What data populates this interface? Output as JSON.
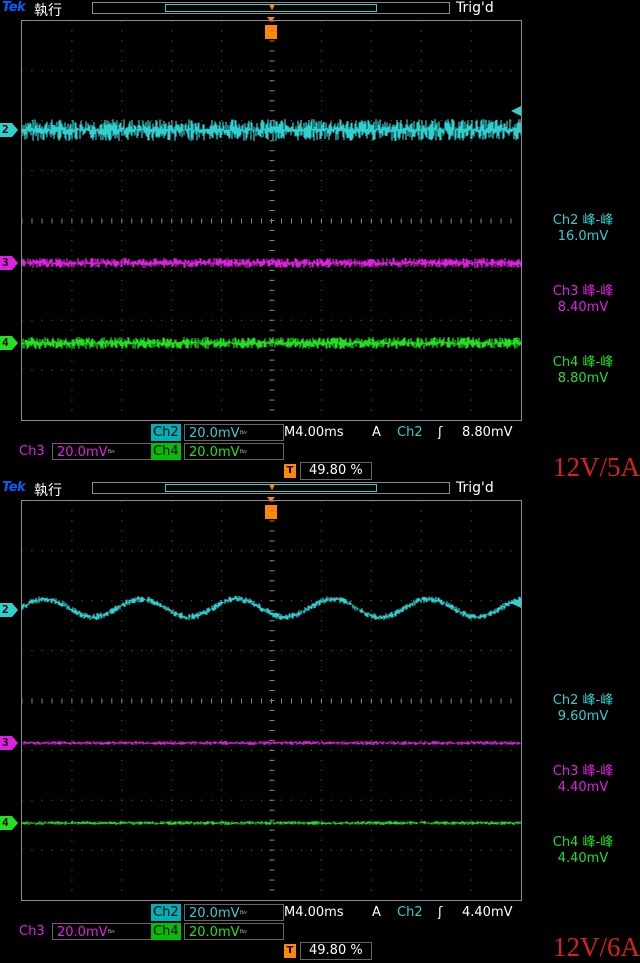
{
  "colors": {
    "ch2": "#30d0d0",
    "ch3": "#e020e0",
    "ch4": "#20e020",
    "trigger": "#ff8800",
    "load": "#d82020"
  },
  "screens": [
    {
      "brand": "Tek",
      "run_label": "執行",
      "trig_state": "Trig'd",
      "trig_marker": "T",
      "channel_markers": [
        "2",
        "3",
        "4"
      ],
      "measurements": [
        {
          "label": "Ch2 峰-峰",
          "value": "16.0mV"
        },
        {
          "label": "Ch3 峰-峰",
          "value": "8.40mV"
        },
        {
          "label": "Ch4 峰-峰",
          "value": "8.80mV"
        }
      ],
      "status": {
        "ch2_name": "Ch2",
        "ch2_scale": "20.0mV",
        "timebase": "M4.00ms",
        "coupling": "A",
        "trig_source": "Ch2",
        "trig_slope": "ʃ",
        "trig_level": "8.80mV",
        "ch3_name": "Ch3",
        "ch3_scale": "20.0mV",
        "ch4_name": "Ch4",
        "ch4_scale": "20.0mV",
        "bw": "ᴮʷ",
        "trig_pos": "49.80 %"
      },
      "load": "12V/5A",
      "waves": {
        "ch2": "noise",
        "ch3": "noise",
        "ch4": "noise"
      }
    },
    {
      "brand": "Tek",
      "run_label": "執行",
      "trig_state": "Trig'd",
      "trig_marker": "T",
      "channel_markers": [
        "2",
        "3",
        "4"
      ],
      "measurements": [
        {
          "label": "Ch2 峰-峰",
          "value": "9.60mV"
        },
        {
          "label": "Ch3 峰-峰",
          "value": "4.40mV"
        },
        {
          "label": "Ch4 峰-峰",
          "value": "4.40mV"
        }
      ],
      "status": {
        "ch2_name": "Ch2",
        "ch2_scale": "20.0mV",
        "timebase": "M4.00ms",
        "coupling": "A",
        "trig_source": "Ch2",
        "trig_slope": "ʃ",
        "trig_level": "4.40mV",
        "ch3_name": "Ch3",
        "ch3_scale": "20.0mV",
        "ch4_name": "Ch4",
        "ch4_scale": "20.0mV",
        "bw": "ᴮʷ",
        "trig_pos": "49.80 %"
      },
      "load": "12V/6A",
      "waves": {
        "ch2": "sine",
        "ch3": "flat",
        "ch4": "flat"
      }
    }
  ]
}
